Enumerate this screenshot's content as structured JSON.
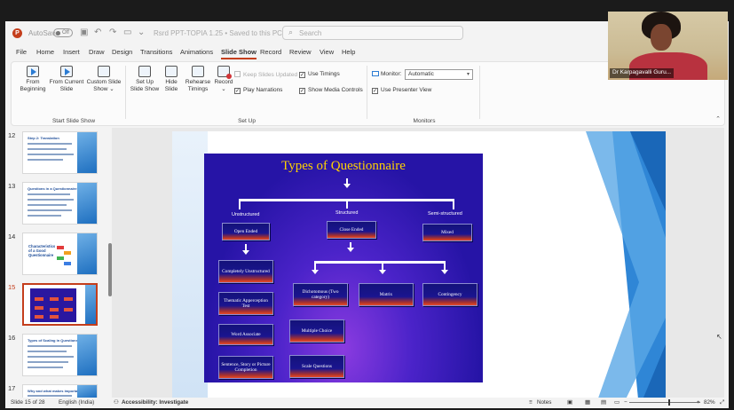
{
  "titlebar": {
    "autosave_label": "AutoSave",
    "autosave_state": "Off",
    "doc_title": "Rsrd PPT-TOPIA 1.25 • Saved to this PC",
    "search_placeholder": "Search"
  },
  "tabs": [
    "File",
    "Home",
    "Insert",
    "Draw",
    "Design",
    "Transitions",
    "Animations",
    "Slide Show",
    "Record",
    "Review",
    "View",
    "Help"
  ],
  "active_tab": "Slide Show",
  "ribbon": {
    "from_beginning": "From Beginning",
    "from_current": "From Current Slide",
    "custom_show": "Custom Slide Show",
    "group_start": "Start Slide Show",
    "setup_show": "Set Up Slide Show",
    "hide_slide": "Hide Slide",
    "rehearse": "Rehearse Timings",
    "record": "Record",
    "keep_updated": "Keep Slides Updated",
    "play_narrations": "Play Narrations",
    "use_timings": "Use Timings",
    "show_media": "Show Media Controls",
    "group_setup": "Set Up",
    "monitor_label": "Monitor:",
    "monitor_value": "Automatic",
    "presenter_view": "Use Presenter View",
    "group_monitors": "Monitors"
  },
  "thumbnails": [
    {
      "num": "12",
      "title": "Step 2: Translation"
    },
    {
      "num": "13",
      "title": "Questions in a Questionnaire"
    },
    {
      "num": "14",
      "title": "Characteristics of a Good Questionnaire"
    },
    {
      "num": "15",
      "title": ""
    },
    {
      "num": "16",
      "title": "Types of Scaling in Questionnaire"
    },
    {
      "num": "17",
      "title": "Why and what makes important"
    }
  ],
  "slide": {
    "title": "Types of Questionnaire",
    "categories": {
      "unstructured": "Unstructured",
      "structured": "Structured",
      "semi": "Semi-structured"
    },
    "nodes": {
      "open_ended": "Open Ended",
      "close_ended": "Close Ended",
      "mixed": "Mixed",
      "completely_unstructured": "Completely Unstructured",
      "tat": "Thematic Apperception Test",
      "word_associate": "Word Associate",
      "sentence_story": "Sentence, Story or Picture Completion",
      "dichotomous": "Dichotomous (Two category)",
      "matrix": "Matrix",
      "contingency": "Contingency",
      "multiple_choice": "Multiple Choice",
      "scale_questions": "Scale Questions"
    }
  },
  "status": {
    "slide_count": "Slide 15 of 28",
    "language": "English (India)",
    "accessibility": "Accessibility: Investigate",
    "notes": "Notes",
    "zoom": "82%"
  },
  "video": {
    "participant_name": "Dr Karpagavalli Guru..."
  },
  "colors": {
    "accent": "#c43e1c",
    "slide_title": "#ffd200",
    "chart_bg": "#2614a6"
  }
}
